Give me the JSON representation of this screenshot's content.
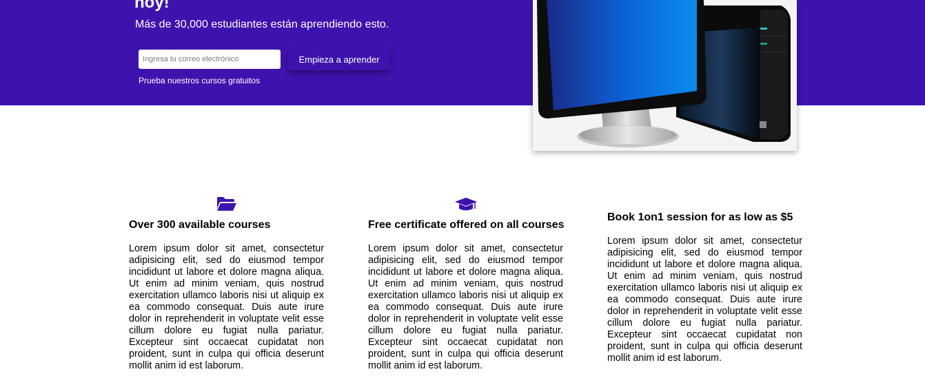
{
  "hero": {
    "title": "hoy!",
    "subtitle": "Más de 30,000 estudiantes están aprendiendo esto.",
    "email_placeholder": "Ingresa tu correo electrónico",
    "cta_label": "Empieza a aprender",
    "free_courses_link": "Prueba nuestros cursos gratuitos",
    "image_subject": "desktop-computer-illustration"
  },
  "features": [
    {
      "icon": "folder-open-icon",
      "title": "Over 300 available courses",
      "text": "Lorem ipsum dolor sit amet, consectetur adipisicing elit, sed do eiusmod tempor incididunt ut labore et dolore magna aliqua. Ut enim ad minim veniam, quis nostrud exercitation ullamco laboris nisi ut aliquip ex ea commodo consequat. Duis aute irure dolor in reprehenderit in voluptate velit esse cillum dolore eu fugiat nulla pariatur. Excepteur sint occaecat cupidatat non proident, sunt in culpa qui officia deserunt mollit anim id est laborum."
    },
    {
      "icon": "graduation-cap-icon",
      "title": "Free certificate offered on all courses",
      "text": "Lorem ipsum dolor sit amet, consectetur adipisicing elit, sed do eiusmod tempor incididunt ut labore et dolore magna aliqua. Ut enim ad minim veniam, quis nostrud exercitation ullamco laboris nisi ut aliquip ex ea commodo consequat. Duis aute irure dolor in reprehenderit in voluptate velit esse cillum dolore eu fugiat nulla pariatur. Excepteur sint occaecat cupidatat non proident, sunt in culpa qui officia deserunt mollit anim id est laborum."
    },
    {
      "icon": "",
      "title": "Book 1on1 session for as low as $5",
      "text": "Lorem ipsum dolor sit amet, consectetur adipisicing elit, sed do eiusmod tempor incididunt ut labore et dolore magna aliqua. Ut enim ad minim veniam, quis nostrud exercitation ullamco laboris nisi ut aliquip ex ea commodo consequat. Duis aute irure dolor in reprehenderit in voluptate velit esse cillum dolore eu fugiat nulla pariatur. Excepteur sint occaecat cupidatat non proident, sunt in culpa qui officia deserunt mollit anim id est laborum."
    }
  ],
  "colors": {
    "brand": "#3e13ad",
    "text": "#000000",
    "background": "#ffffff"
  }
}
